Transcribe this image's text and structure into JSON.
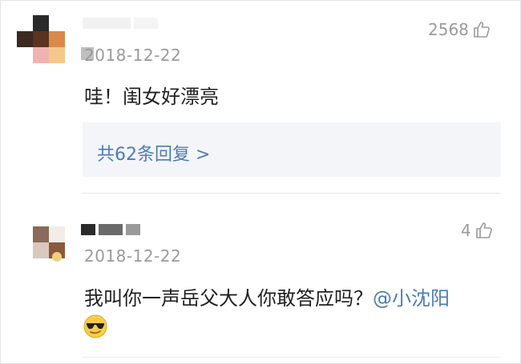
{
  "comments": [
    {
      "date": "2018-12-22",
      "likes": "2568",
      "text": "哇！闺女好漂亮",
      "reply_summary": "共62条回复 >"
    },
    {
      "date": "2018-12-22",
      "likes": "4",
      "text": "我叫你一声岳父大人你敢答应吗？",
      "mention": "@小沈阳",
      "emoji": "sunglasses-emoji"
    }
  ],
  "colors": {
    "link": "#4a7cb8",
    "meta": "#9a9a9a",
    "reply_bg": "#f4f5f8"
  }
}
